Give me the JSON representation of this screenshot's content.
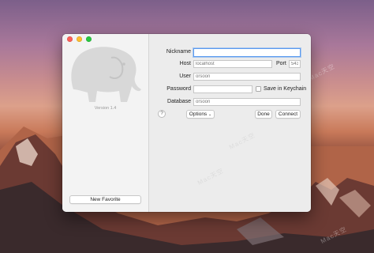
{
  "sidebar": {
    "version": "Version 1.4",
    "new_favorite": "New Favorite"
  },
  "form": {
    "nickname": {
      "label": "Nickname",
      "value": "",
      "placeholder": ""
    },
    "host": {
      "label": "Host",
      "placeholder": "localhost"
    },
    "port": {
      "label": "Port",
      "placeholder": "5432"
    },
    "user": {
      "label": "User",
      "placeholder": "orsoon"
    },
    "password": {
      "label": "Password",
      "placeholder": ""
    },
    "keychain": {
      "label": "Save in Keychain",
      "checked": false
    },
    "database": {
      "label": "Database",
      "placeholder": "orsoon"
    }
  },
  "actions": {
    "help": "?",
    "options": "Options",
    "done": "Done",
    "connect": "Connect"
  },
  "watermark": "Mac天空",
  "colors": {
    "focus": "#5b9bf0",
    "red": "#fd5f57",
    "yellow": "#fdbd2e",
    "green": "#28c840"
  }
}
